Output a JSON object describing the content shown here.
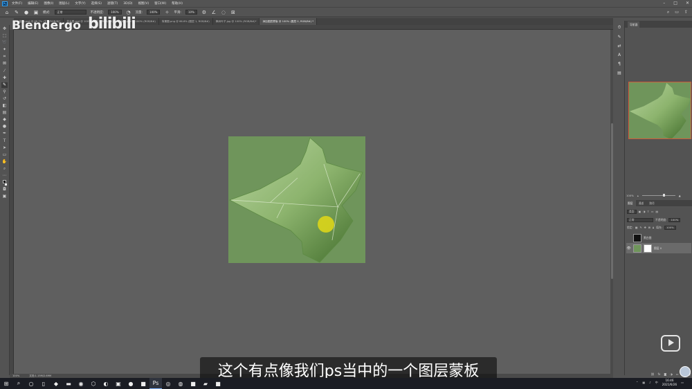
{
  "menubar": {
    "items": [
      "文件(F)",
      "编辑(E)",
      "图像(I)",
      "图层(L)",
      "文字(Y)",
      "选择(S)",
      "滤镜(T)",
      "3D(D)",
      "视图(V)",
      "窗口(W)",
      "帮助(H)"
    ]
  },
  "options": {
    "mode_label": "模式:",
    "mode_value": "正常",
    "opacity_label": "不透明度:",
    "opacity_value": "100%",
    "flow_label": "流量:",
    "flow_value": "100%",
    "smooth_label": "平滑:",
    "smooth_value": "10%"
  },
  "tabs": [
    {
      "label": "火焰ps.psd @ 66.7% (文字/RGB/8)*"
    },
    {
      "label": "花大图.psd @ 100% (图层 1, RGB/8#)*"
    },
    {
      "label": "树枝.psd @ 100% (RGB/8#)"
    },
    {
      "label": "背景图.png @ 66.6% (图层 1, RGB/8#)"
    },
    {
      "label": "枫树叶子.jpg @ 100% (RGB/8#)*"
    },
    {
      "label": "添加图层蒙版 @ 100% (图层 0, RGB/8#) *"
    }
  ],
  "watermark": {
    "text": "Blendergo",
    "bili": "bilibili"
  },
  "statusbar": {
    "zoom": "100%",
    "docinfo": "文档:1.15M/2.69M"
  },
  "navigator": {
    "title": "导航器",
    "zoom": "100%"
  },
  "layers": {
    "tabs": [
      "图层",
      "通道",
      "路径"
    ],
    "kind_label": "类型",
    "blend_mode": "正常",
    "opacity_label": "不透明度:",
    "opacity_value": "100%",
    "lock_label": "锁定:",
    "fill_label": "填充:",
    "fill_value": "100%",
    "items": [
      {
        "name": "黑白图",
        "visible": false
      },
      {
        "name": "图层 0",
        "visible": true
      }
    ]
  },
  "subtitle": "这个有点像我们ps当中的一个图层蒙板",
  "clock": {
    "time": "16:46",
    "date": "2021/6/26"
  },
  "colors": {
    "canvas_bg": "#6f955b",
    "highlight": "#d6d21c",
    "accent": "#31a8ff"
  }
}
